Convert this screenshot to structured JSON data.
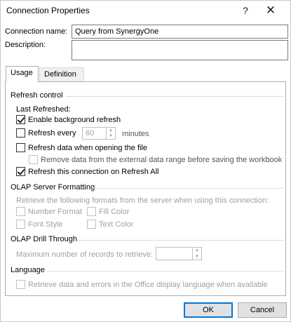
{
  "window": {
    "title": "Connection Properties",
    "help": "?",
    "close": "✕"
  },
  "connection": {
    "name_label": "Connection name:",
    "name_value": "Query from SynergyOne",
    "description_label": "Description:",
    "description_value": ""
  },
  "tabs": [
    {
      "label": "Usage",
      "selected": true
    },
    {
      "label": "Definition",
      "selected": false
    }
  ],
  "refresh": {
    "section": "Refresh control",
    "last_refreshed": "Last Refreshed:",
    "enable_background": {
      "label": "Enable background refresh",
      "checked": true
    },
    "refresh_every": {
      "label": "Refresh every",
      "checked": false
    },
    "refresh_every_value": "60",
    "refresh_every_unit": "minutes",
    "refresh_on_open": {
      "label": "Refresh data when opening the file",
      "checked": false
    },
    "remove_data": {
      "label": "Remove data from the external data range before saving the workbook",
      "checked": false,
      "disabled": true
    },
    "refresh_all": {
      "label": "Refresh this connection on Refresh All",
      "checked": true
    }
  },
  "olap_format": {
    "section": "OLAP Server Formatting",
    "description": "Retrieve the following formats from the server when using this connection:",
    "number_format": "Number Format",
    "fill_color": "Fill Color",
    "font_style": "Font Style",
    "text_color": "Text Color"
  },
  "olap_drill": {
    "section": "OLAP Drill Through",
    "max_records_label": "Maximum number of records to retrieve:",
    "max_records_value": ""
  },
  "language": {
    "section": "Language",
    "retrieve_label": "Retrieve data and errors in the Office display language when available"
  },
  "buttons": {
    "ok": "OK",
    "cancel": "Cancel"
  }
}
